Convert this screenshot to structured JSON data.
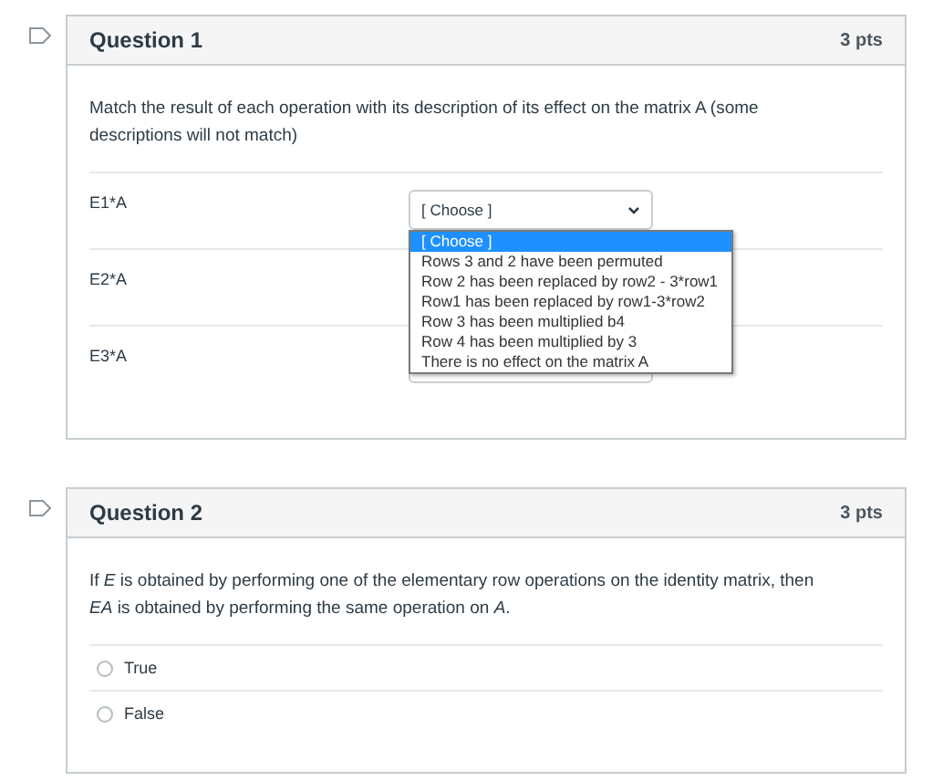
{
  "questions": [
    {
      "title": "Question 1",
      "points": "3 pts",
      "kind": "matching",
      "prompt": "Match the result of each operation with its description of its effect on the matrix A (some descriptions will not match)",
      "rows": [
        {
          "label": "E1*A",
          "kind": "dropdown",
          "value": "[ Choose ]",
          "open": true
        },
        {
          "label": "E2*A",
          "kind": "label"
        },
        {
          "label": "E3*A",
          "kind": "dropdown"
        }
      ],
      "options": [
        {
          "label": "[ Choose ]",
          "selected": true
        },
        {
          "label": "Rows 3 and 2 have been permuted",
          "selected": false
        },
        {
          "label": "Row 2 has been replaced by row2 - 3*row1",
          "selected": false
        },
        {
          "label": "Row1 has been replaced by row1-3*row2",
          "selected": false
        },
        {
          "label": "Row 3 has been multiplied b4",
          "selected": false
        },
        {
          "label": "Row 4 has been multiplied by 3",
          "selected": false
        },
        {
          "label": "There is no effect on the matrix A",
          "selected": false
        }
      ]
    },
    {
      "title": "Question 2",
      "points": "3 pts",
      "kind": "choice",
      "prompt": "If *E* is obtained by performing one of the elementary row operations on the identity matrix, then *EA* is obtained by performing the same operation  on *A*.",
      "answers": [
        {
          "label": "True",
          "selected": false
        },
        {
          "label": "False",
          "selected": false
        }
      ]
    }
  ]
}
